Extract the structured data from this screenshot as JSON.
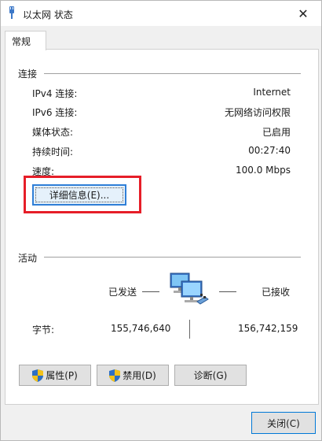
{
  "window": {
    "title": "以太网 状态"
  },
  "tabs": [
    {
      "label": "常规"
    }
  ],
  "connection": {
    "section_label": "连接",
    "rows": [
      {
        "label": "IPv4 连接:",
        "value": "Internet"
      },
      {
        "label": "IPv6 连接:",
        "value": "无网络访问权限"
      },
      {
        "label": "媒体状态:",
        "value": "已启用"
      },
      {
        "label": "持续时间:",
        "value": "00:27:40"
      },
      {
        "label": "速度:",
        "value": "100.0 Mbps"
      }
    ],
    "details_button": "详细信息(E)..."
  },
  "activity": {
    "section_label": "活动",
    "sent_label": "已发送",
    "received_label": "已接收",
    "bytes_label": "字节:",
    "bytes_sent": "155,746,640",
    "bytes_received": "156,742,159"
  },
  "buttons": {
    "properties": "属性(P)",
    "disable": "禁用(D)",
    "diagnose": "诊断(G)",
    "close": "关闭(C)"
  },
  "icons": {
    "title": "ethernet-plug-icon",
    "network": "network-computers-icon",
    "shield": "uac-shield-icon",
    "close": "close-icon"
  },
  "colors": {
    "highlight": "#e61e28",
    "focus_border": "#2f7fd7",
    "button_bg": "#e1e1e1"
  }
}
